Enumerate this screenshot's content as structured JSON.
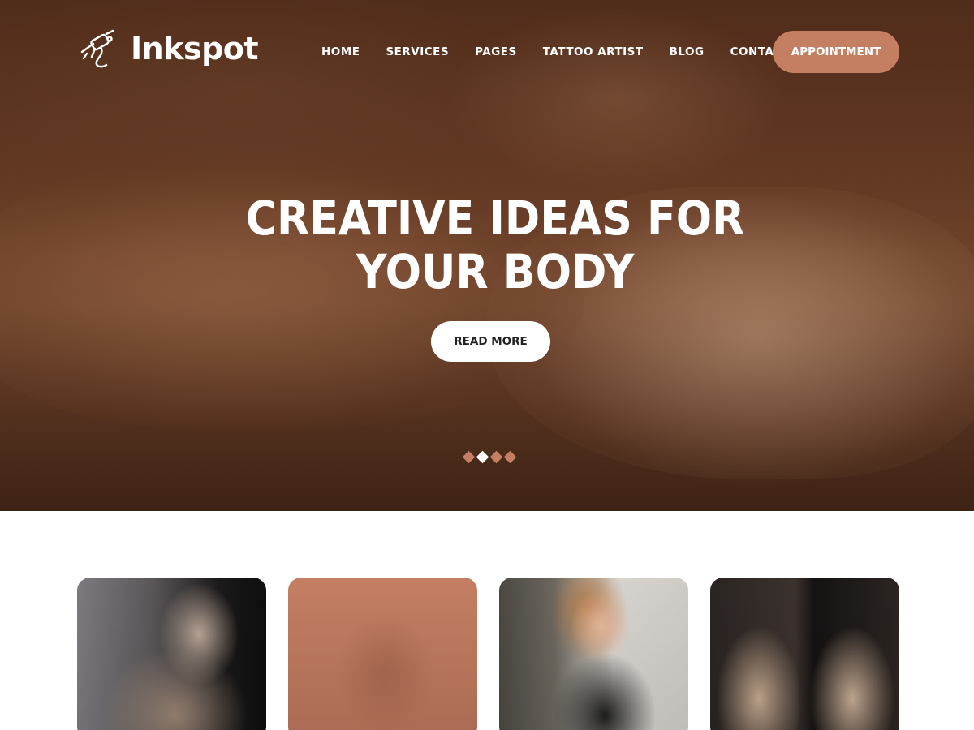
{
  "brand": {
    "name": "Inkspot",
    "icon": "tattoo-machine-icon"
  },
  "nav": {
    "items": [
      {
        "label": "HOME"
      },
      {
        "label": "SERVICES"
      },
      {
        "label": "PAGES"
      },
      {
        "label": "TATTOO ARTIST"
      },
      {
        "label": "BLOG"
      },
      {
        "label": "CONTACT"
      }
    ],
    "cta_label": "APPOINTMENT"
  },
  "hero": {
    "title_line1": "CREATIVE IDEAS FOR",
    "title_line2": "YOUR BODY",
    "button_label": "READ MORE",
    "slides_total": 4,
    "active_slide": 2
  },
  "cards": [
    {
      "subject": "tattooed man portrait"
    },
    {
      "subject": "man with hand on face"
    },
    {
      "subject": "woman with tattooed arms"
    },
    {
      "subject": "shoulder wing tattoos"
    }
  ],
  "colors": {
    "accent": "#c47f63",
    "white": "#ffffff",
    "dark_text": "#222222"
  }
}
